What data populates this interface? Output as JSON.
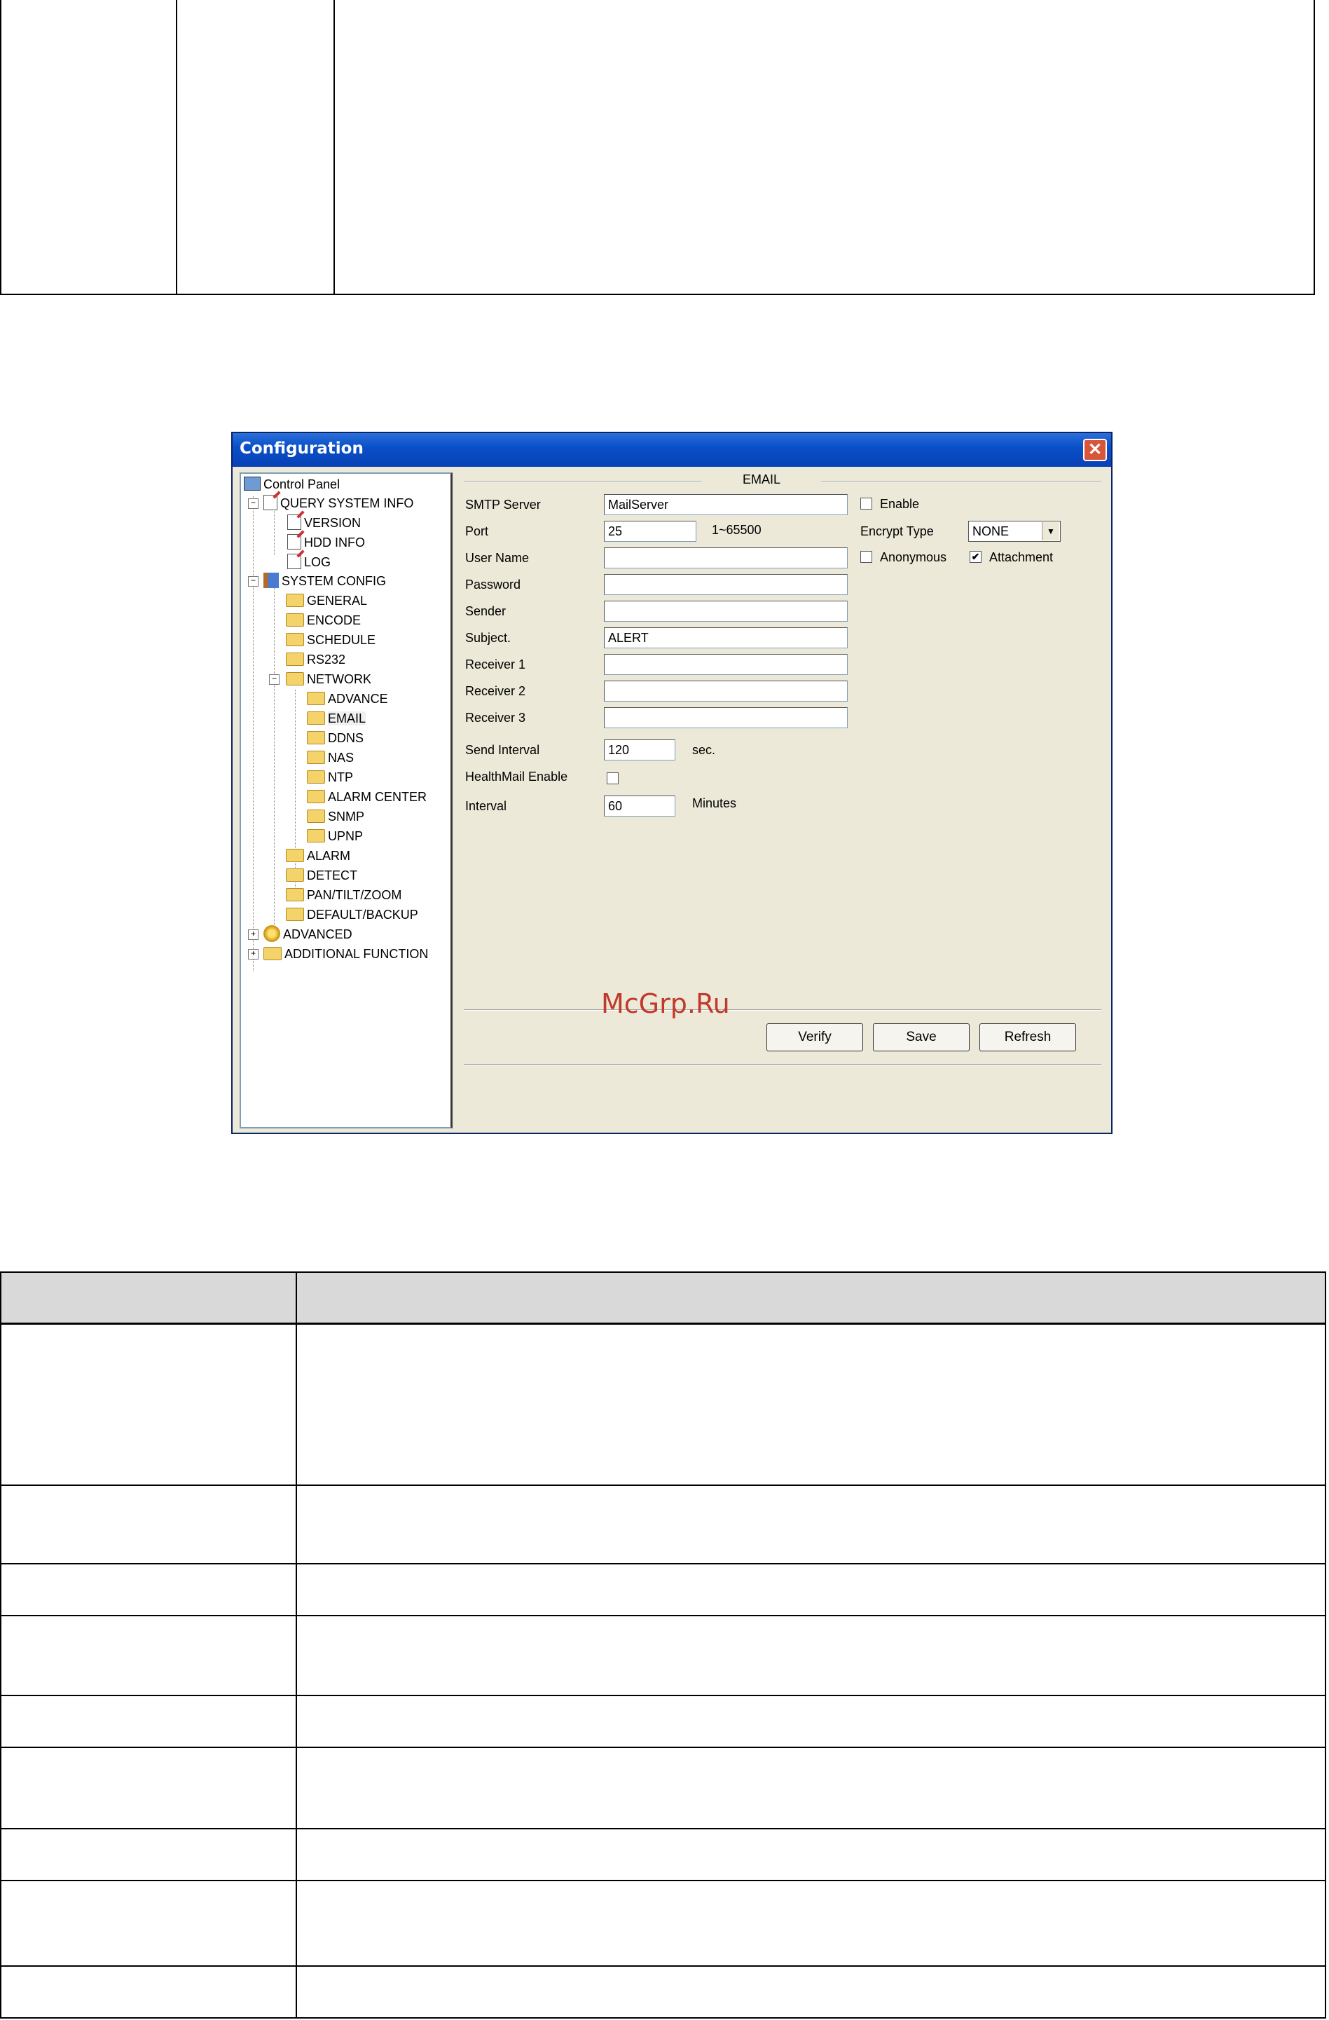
{
  "window": {
    "title": "Configuration",
    "close_glyph": "✕"
  },
  "tree": {
    "root": "Control Panel",
    "query_system_info": "QUERY SYSTEM INFO",
    "version": "VERSION",
    "hdd_info": "HDD INFO",
    "log": "LOG",
    "system_config": "SYSTEM CONFIG",
    "general": "GENERAL",
    "encode": "ENCODE",
    "schedule": "SCHEDULE",
    "rs232": "RS232",
    "network": "NETWORK",
    "advance": "ADVANCE",
    "email": "EMAIL",
    "ddns": "DDNS",
    "nas": "NAS",
    "ntp": "NTP",
    "alarm_center": "ALARM CENTER",
    "snmp": "SNMP",
    "upnp": "UPNP",
    "alarm": "ALARM",
    "detect": "DETECT",
    "pan_tilt_zoom": "PAN/TILT/ZOOM",
    "default_backup": "DEFAULT/BACKUP",
    "advanced": "ADVANCED",
    "additional_function": "ADDITIONAL FUNCTION"
  },
  "email": {
    "section_title": "EMAIL",
    "smtp_server_label": "SMTP Server",
    "smtp_server_value": "MailServer",
    "enable_label": "Enable",
    "port_label": "Port",
    "port_value": "25",
    "port_range": "1~65500",
    "encrypt_type_label": "Encrypt Type",
    "encrypt_type_value": "NONE",
    "user_name_label": "User Name",
    "anonymous_label": "Anonymous",
    "attachment_label": "Attachment",
    "attachment_checked": "✔",
    "password_label": "Password",
    "sender_label": "Sender",
    "subject_label": "Subject.",
    "subject_value": "ALERT",
    "receiver1_label": "Receiver 1",
    "receiver2_label": "Receiver 2",
    "receiver3_label": "Receiver 3",
    "send_interval_label": "Send Interval",
    "send_interval_value": "120",
    "send_interval_unit": "sec.",
    "healthmail_label": "HealthMail Enable",
    "interval_label": "Interval",
    "interval_value": "60",
    "interval_unit": "Minutes"
  },
  "buttons": {
    "verify": "Verify",
    "save": "Save",
    "refresh": "Refresh"
  },
  "watermark": "McGrp.Ru"
}
